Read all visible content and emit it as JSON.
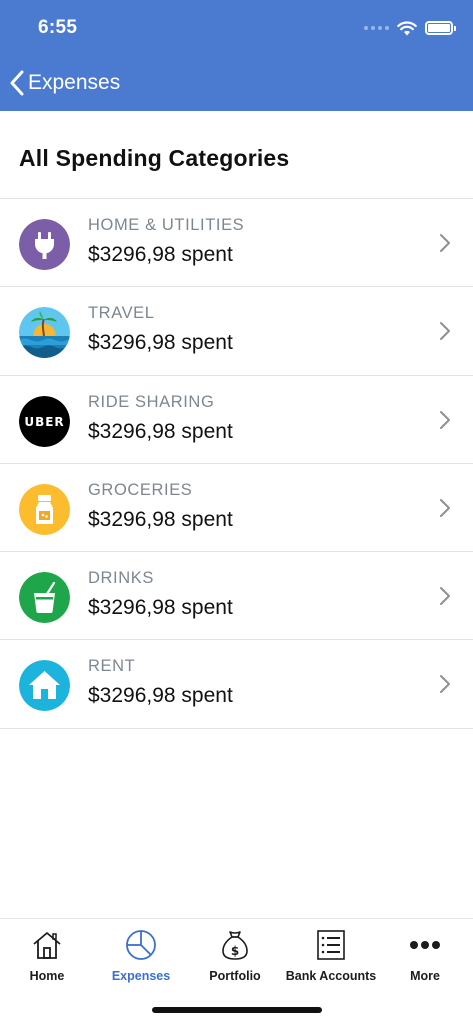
{
  "status_bar": {
    "time": "6:55"
  },
  "nav": {
    "back_label": "Expenses"
  },
  "section_title": "All Spending Categories",
  "categories": [
    {
      "name": "HOME & UTILITIES",
      "amount": "$3296,98 spent",
      "icon": "plug-icon",
      "color": "#7b5ea7"
    },
    {
      "name": "TRAVEL",
      "amount": "$3296,98 spent",
      "icon": "beach-icon",
      "color": "#4fc3f7"
    },
    {
      "name": "RIDE SHARING",
      "amount": "$3296,98 spent",
      "icon": "uber-logo-icon",
      "color": "#000000",
      "icon_text": "UBER"
    },
    {
      "name": "GROCERIES",
      "amount": "$3296,98 spent",
      "icon": "grocery-jar-icon",
      "color": "#fbbd2e"
    },
    {
      "name": "DRINKS",
      "amount": "$3296,98 spent",
      "icon": "drink-cup-icon",
      "color": "#1fa64a"
    },
    {
      "name": "RENT",
      "amount": "$3296,98 spent",
      "icon": "house-icon",
      "color": "#1cb4dc"
    }
  ],
  "tabs": [
    {
      "label": "Home",
      "icon": "home-icon",
      "active": false
    },
    {
      "label": "Expenses",
      "icon": "pie-chart-icon",
      "active": true
    },
    {
      "label": "Portfolio",
      "icon": "money-bag-icon",
      "active": false
    },
    {
      "label": "Bank Accounts",
      "icon": "list-icon",
      "active": false
    },
    {
      "label": "More",
      "icon": "more-icon",
      "active": false
    }
  ],
  "colors": {
    "header": "#4a7bd1",
    "accent": "#3d6fcf",
    "category_text": "#7d8791"
  }
}
